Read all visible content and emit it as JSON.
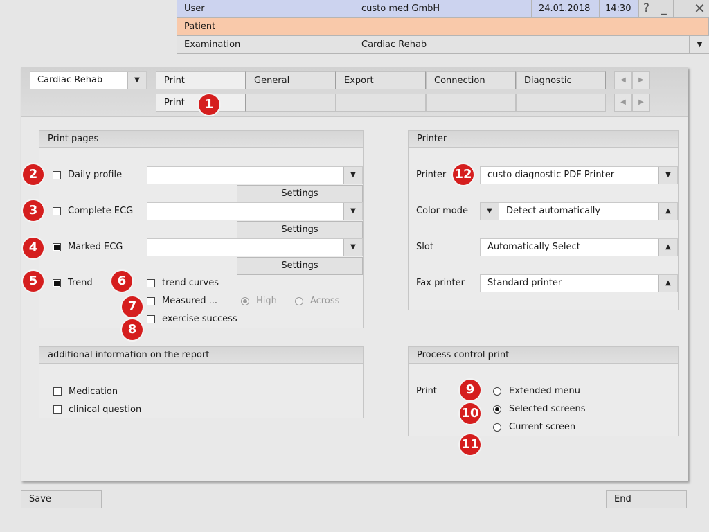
{
  "header": {
    "user_label": "User",
    "user_value": "custo med GmbH",
    "date": "24.01.2018",
    "time": "14:30",
    "help_icon": "question-icon",
    "minimize_icon": "minimize-icon",
    "close_icon": "close-icon",
    "patient_label": "Patient",
    "patient_value": "",
    "exam_label": "Examination",
    "exam_value": "Cardiac Rehab",
    "colors": {
      "user_row": "#ccd3ef",
      "patient_row": "#f9c9aa"
    }
  },
  "toolbar": {
    "mode_select": "Cardiac Rehab",
    "tabs": [
      "Print",
      "General",
      "Export",
      "Connection",
      "Diagnostic"
    ],
    "subtabs": [
      "Print"
    ],
    "nav_prev": "◀",
    "nav_next": "▶"
  },
  "print_pages": {
    "title": "Print pages",
    "items": [
      {
        "label": "Daily profile",
        "checked": false,
        "select": "",
        "settings": "Settings"
      },
      {
        "label": "Complete ECG",
        "checked": false,
        "select": "",
        "settings": "Settings"
      },
      {
        "label": "Marked ECG",
        "checked": true,
        "select": "",
        "settings": "Settings"
      }
    ],
    "trend": {
      "label": "Trend",
      "checked": true
    },
    "trend_curves": "trend curves",
    "measured": "Measured ...",
    "high": "High",
    "across": "Across",
    "exercise_success": "exercise success"
  },
  "additional": {
    "title": "additional information on the report",
    "medication": "Medication",
    "clinical_question": "clinical question"
  },
  "printer": {
    "title": "Printer",
    "printer_label": "Printer",
    "printer_value": "custo diagnostic PDF Printer",
    "color_mode_label": "Color mode",
    "color_mode_value": "Detect automatically",
    "slot_label": "Slot",
    "slot_value": "Automatically Select",
    "fax_label": "Fax printer",
    "fax_value": "Standard printer"
  },
  "process": {
    "title": "Process control print",
    "print_label": "Print",
    "options": [
      "Extended menu",
      "Selected screens",
      "Current screen"
    ],
    "selected": "Selected screens"
  },
  "footer": {
    "save": "Save",
    "end": "End"
  },
  "markers": [
    "1",
    "2",
    "3",
    "4",
    "5",
    "6",
    "7",
    "8",
    "9",
    "10",
    "11",
    "12"
  ],
  "marker_color": "#d51e1e"
}
